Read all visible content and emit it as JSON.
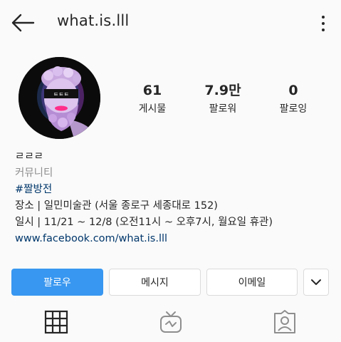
{
  "header": {
    "username": "what.is.lll"
  },
  "stats": [
    {
      "value": "61",
      "label": "게시물"
    },
    {
      "value": "7.9만",
      "label": "팔로워"
    },
    {
      "value": "0",
      "label": "팔로잉"
    }
  ],
  "avatar": {
    "badge_text": "ㅌㅌㅌ"
  },
  "bio": {
    "name": "ㄹㄹㄹ",
    "category": "커뮤니티",
    "hashtag": "#짤방전",
    "line1": "장소 | 일민미술관 (서울 종로구 세종대로 152)",
    "line2": "일시 | 11/21 ~ 12/8 (오전11시 ~ 오후7시, 월요일 휴관)",
    "link": "www.facebook.com/what.is.lll"
  },
  "actions": {
    "follow": "팔로우",
    "message": "메시지",
    "email": "이메일"
  },
  "tabs": [
    {
      "icon": "grid-icon"
    },
    {
      "icon": "igtv-icon"
    },
    {
      "icon": "tagged-icon"
    }
  ],
  "colors": {
    "primary": "#3897f0",
    "link": "#00376b",
    "muted": "#8e8e8e"
  }
}
